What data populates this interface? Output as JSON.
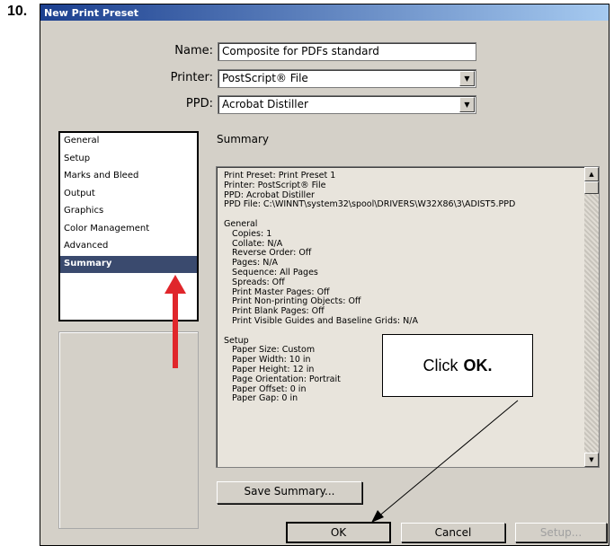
{
  "step_number": "10.",
  "dialog": {
    "title": "New Print Preset",
    "name_label": "Name:",
    "name_value": "Composite for PDFs standard",
    "printer_label": "Printer:",
    "printer_value": "PostScript® File",
    "ppd_label": "PPD:",
    "ppd_value": "Acrobat Distiller"
  },
  "sidebar": {
    "items": [
      {
        "label": "General"
      },
      {
        "label": "Setup"
      },
      {
        "label": "Marks and Bleed"
      },
      {
        "label": "Output"
      },
      {
        "label": "Graphics"
      },
      {
        "label": "Color Management"
      },
      {
        "label": "Advanced"
      },
      {
        "label": "Summary",
        "selected": true
      }
    ]
  },
  "summary": {
    "title": "Summary",
    "text": "Print Preset: Print Preset 1\nPrinter: PostScript® File\nPPD: Acrobat Distiller\nPPD File: C:\\WINNT\\system32\\spool\\DRIVERS\\W32X86\\3\\ADIST5.PPD\n\nGeneral\n   Copies: 1\n   Collate: N/A\n   Reverse Order: Off\n   Pages: N/A\n   Sequence: All Pages\n   Spreads: Off\n   Print Master Pages: Off\n   Print Non-printing Objects: Off\n   Print Blank Pages: Off\n   Print Visible Guides and Baseline Grids: N/A\n\nSetup\n   Paper Size: Custom\n   Paper Width: 10 in\n   Paper Height: 12 in\n   Page Orientation: Portrait\n   Paper Offset: 0 in\n   Paper Gap: 0 in"
  },
  "buttons": {
    "save_summary": "Save Summary...",
    "ok": "OK",
    "cancel": "Cancel",
    "setup": "Setup..."
  },
  "callout": {
    "prefix": "Click",
    "emphasis": "OK."
  },
  "colors": {
    "title_bar": "#1b3f8f",
    "selected_item": "#3a4a6e",
    "arrow": "#e0262b"
  }
}
